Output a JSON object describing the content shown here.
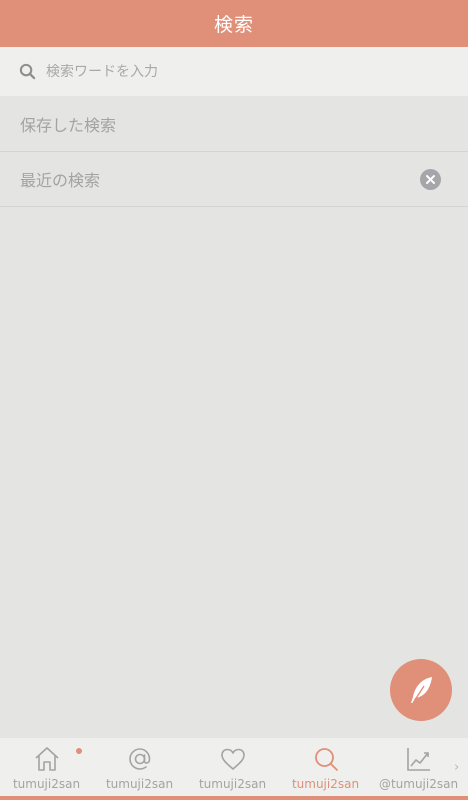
{
  "header": {
    "title": "検索"
  },
  "search": {
    "placeholder": "検索ワードを入力",
    "value": ""
  },
  "sections": {
    "saved_label": "保存した検索",
    "recent_label": "最近の検索"
  },
  "tabs": [
    {
      "label": "tumuji2san",
      "icon": "home-icon",
      "has_notification": true
    },
    {
      "label": "tumuji2san",
      "icon": "at-mention-icon"
    },
    {
      "label": "tumuji2san",
      "icon": "heart-icon"
    },
    {
      "label": "tumuji2san",
      "icon": "search-icon",
      "active": true
    },
    {
      "label": "@tumuji2san",
      "icon": "chart-icon"
    }
  ],
  "more_arrow": "›",
  "colors": {
    "accent": "#e08f78",
    "background": "#e4e4e3",
    "bar": "#eff0ed",
    "muted_text": "#a3a3a3"
  }
}
